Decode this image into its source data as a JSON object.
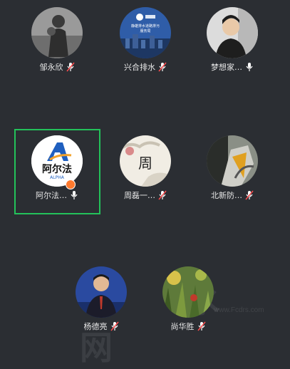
{
  "participants": [
    {
      "name": "邹永欣",
      "mic": "muted"
    },
    {
      "name": "兴合排水",
      "mic": "muted"
    },
    {
      "name": "梦想家…",
      "mic": "on"
    },
    {
      "name": "阿尔法…",
      "mic": "on",
      "active": true,
      "logo_text": "阿尔法",
      "logo_sub": "ALPHA"
    },
    {
      "name": "周磊一…",
      "mic": "muted",
      "avatar_char": "周"
    },
    {
      "name": "北新防…",
      "mic": "muted"
    },
    {
      "name": "杨德亮",
      "mic": "muted"
    },
    {
      "name": "尚华胜",
      "mic": "muted"
    }
  ],
  "avatar_texts": {
    "xinghe_line1": "静雄排水道路排污",
    "xinghe_line2": "服务局"
  },
  "watermark": {
    "text": "水网",
    "url": "www.Fcdrs.com"
  },
  "colors": {
    "background": "#2b2e33",
    "active_border": "#23c25a",
    "muted_icon": "#ffffff",
    "mute_slash": "#ff4d4f"
  }
}
